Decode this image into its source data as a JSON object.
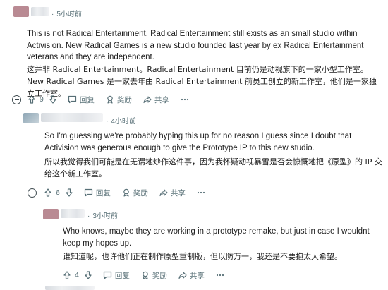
{
  "comments": [
    {
      "time": "5小时前",
      "text_en": "This is not Radical Entertainment. Radical Entertainment still exists as an small studio within Activision. New Radical Games is a new studio founded last year by ex Radical Entertainment veterans and they are independent.",
      "text_zh": "这并非 Radical Entertainment。Radical Entertainment 目前仍是动视旗下的一家小型工作室。New Radical Games 是一家去年由 Radical Entertainment 前员工创立的新工作室，他们是一家独立工作室。",
      "votes": "9",
      "reply_label": "回复",
      "award_label": "奖励",
      "share_label": "共享"
    },
    {
      "time": "4小时前",
      "text_en": "So I'm guessing we're probably hyping this up for no reason I guess since I doubt that Activision was generous enough to give the Prototype IP to this new studio.",
      "text_zh": "所以我觉得我们可能是在无谓地炒作这件事，因为我怀疑动视暴雪是否会慷慨地把《原型》的 IP 交给这个新工作室。",
      "votes": "6",
      "reply_label": "回复",
      "award_label": "奖励",
      "share_label": "共享"
    },
    {
      "time": "3小时前",
      "text_en": "Who knows, maybe they are working in a prototype remake, but just in case I wouldnt keep my hopes up.",
      "text_zh": "谁知道呢，也许他们正在制作原型重制版，但以防万一，我还是不要抱太大希望。",
      "votes": "4",
      "reply_label": "回复",
      "award_label": "奖励",
      "share_label": "共享"
    }
  ],
  "colors": {
    "meta": "#576f76",
    "text": "#1c1c1c",
    "thread": "#e3e5e8"
  }
}
